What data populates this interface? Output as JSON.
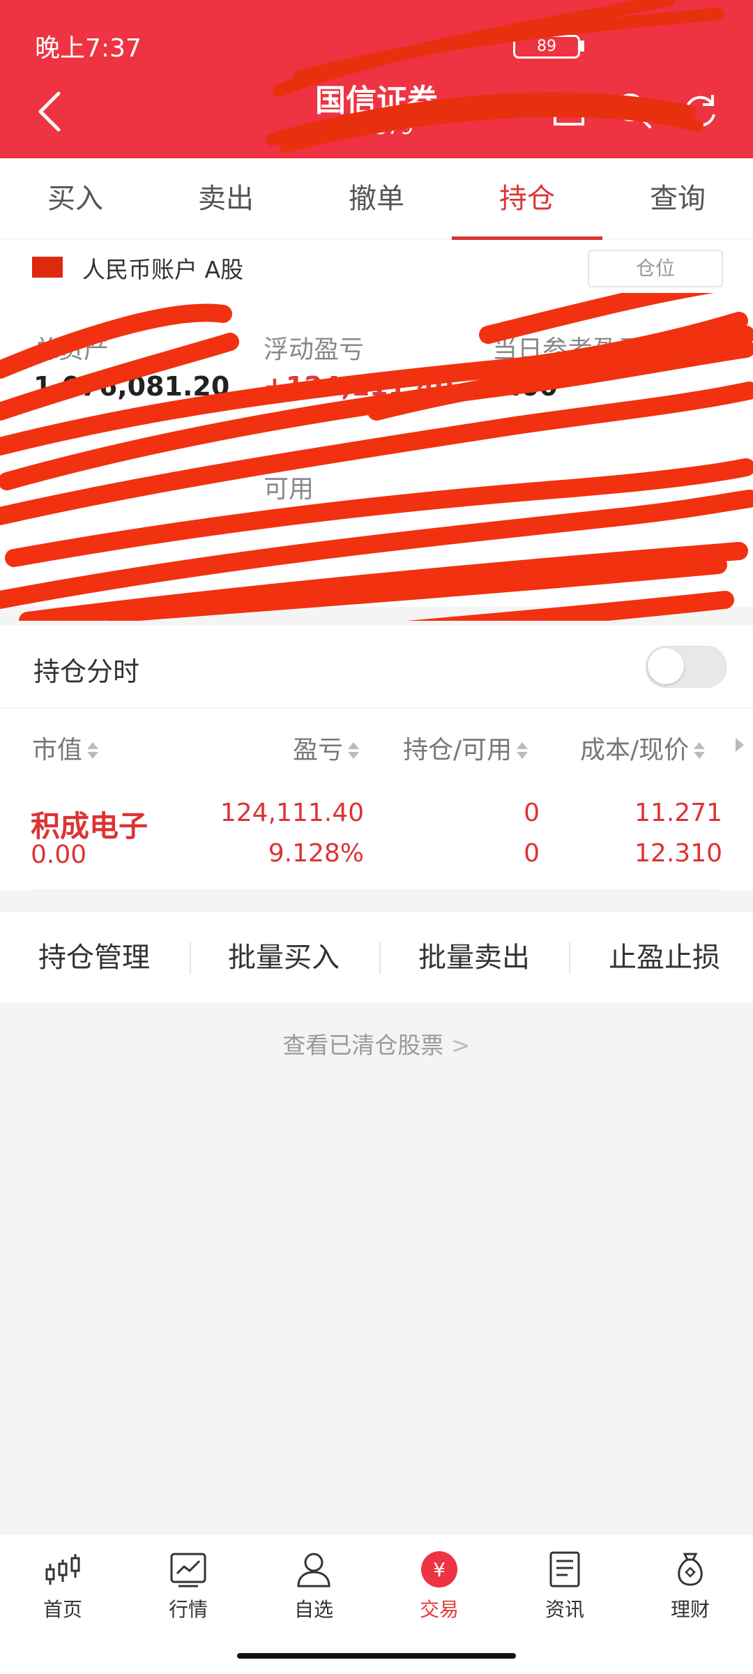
{
  "status_bar": {
    "time": "晚上7:37",
    "battery": "89"
  },
  "header": {
    "title": "国信证券",
    "account": "**1879"
  },
  "tabs": [
    "买入",
    "卖出",
    "撤单",
    "持仓",
    "查询"
  ],
  "active_tab": 3,
  "account_row": {
    "name": "人民币账户 A股",
    "position_button": "仓位"
  },
  "summary": {
    "total_assets_label": "总资产",
    "total_assets_value": "1,076,081.20",
    "floating_pl_label": "浮动盈亏",
    "floating_pl_value": "+124,111.40",
    "daily_ref_label": "当日参考盈亏",
    "daily_ref_value": "0.00",
    "available_label": "可用"
  },
  "holding_timeshare": {
    "label": "持仓分时",
    "enabled": false
  },
  "table": {
    "headers": [
      "市值",
      "盈亏",
      "持仓/可用",
      "成本/现价"
    ],
    "rows": [
      {
        "name": "积成电子",
        "market_value": "0.00",
        "pl": "124,111.40",
        "pl_pct": "9.128%",
        "hold": "0",
        "avail": "0",
        "cost": "11.271",
        "price": "12.310"
      }
    ]
  },
  "actions": [
    "持仓管理",
    "批量买入",
    "批量卖出",
    "止盈止损"
  ],
  "cleared_link": "查看已清仓股票",
  "bottom_nav": [
    "首页",
    "行情",
    "自选",
    "交易",
    "资讯",
    "理财"
  ],
  "bottom_nav_active": 3,
  "colors": {
    "header_red": "#ee3342",
    "accent_red": "#d33"
  }
}
